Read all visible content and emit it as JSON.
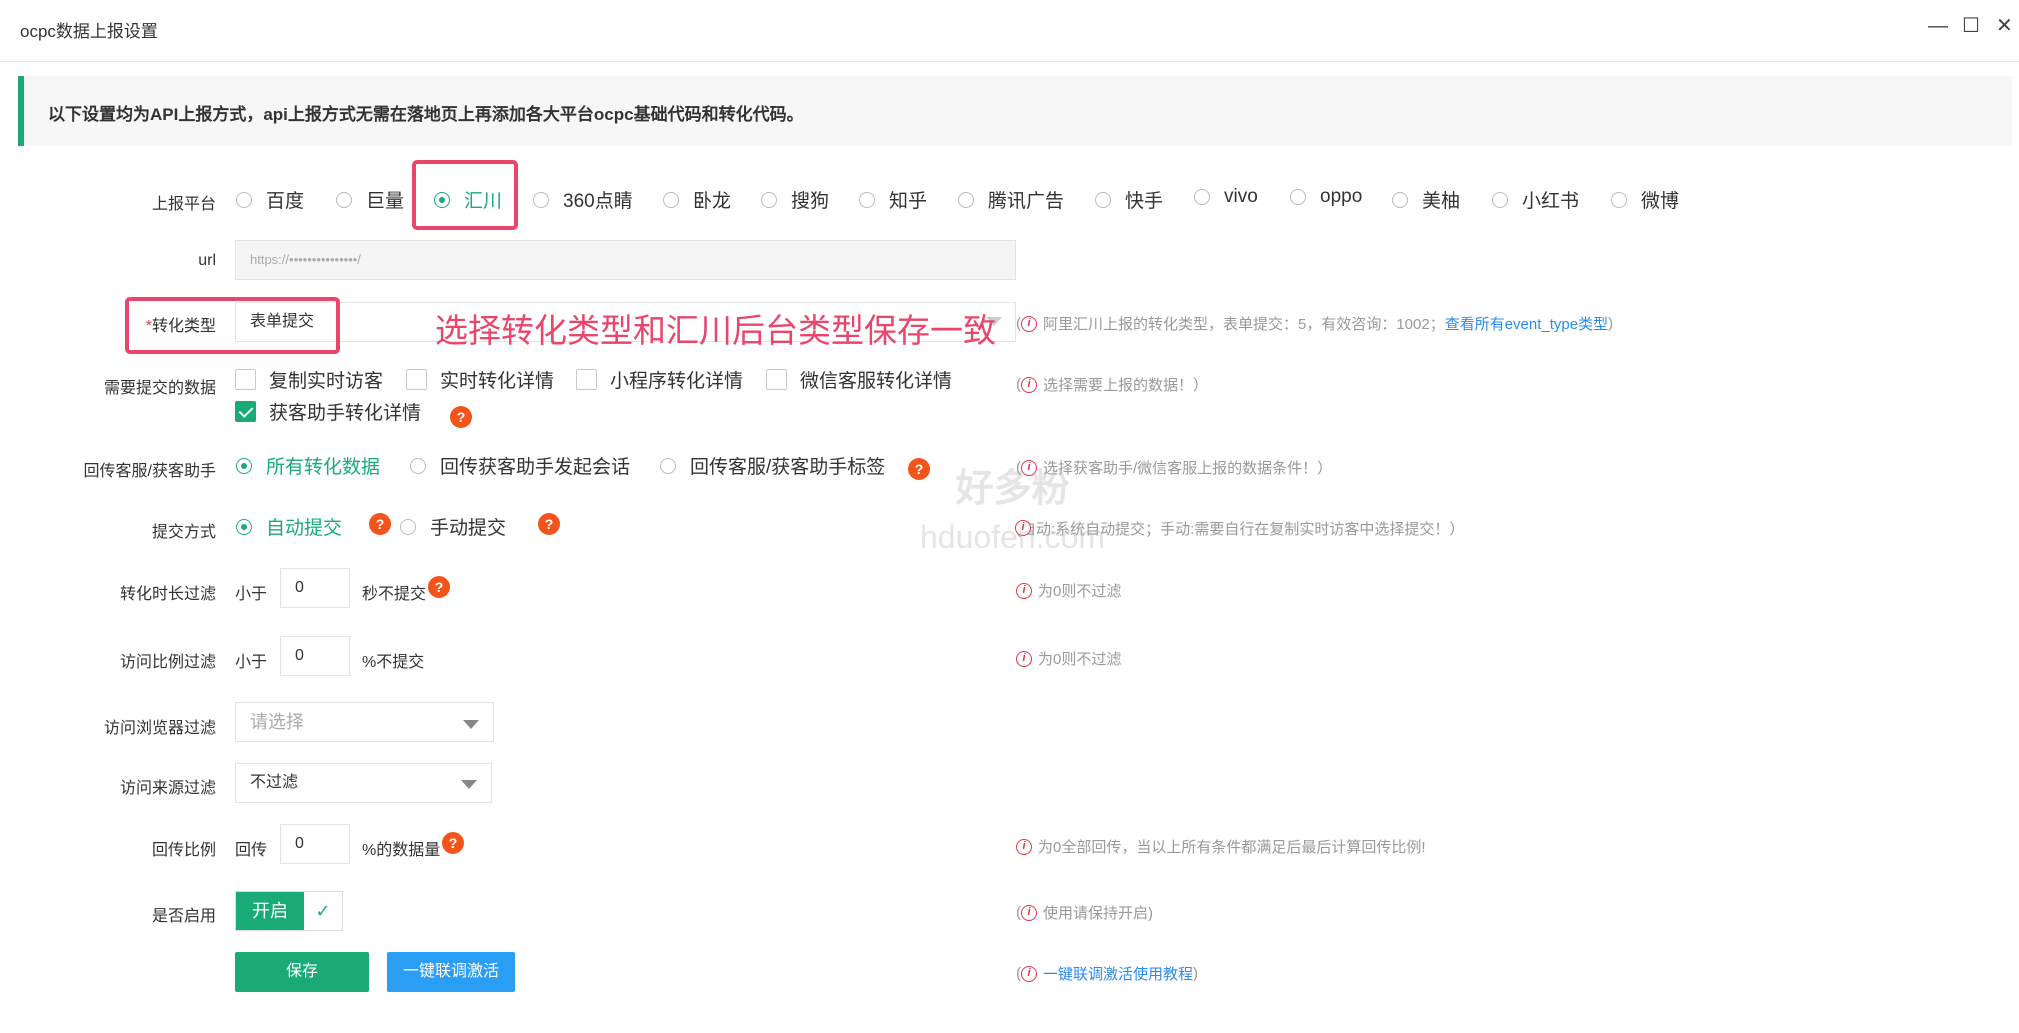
{
  "window": {
    "title": "ocpc数据上报设置",
    "minimize_icon": "—",
    "maximize_icon": "☐",
    "close_icon": "✕"
  },
  "notice": "以下设置均为API上报方式，api上报方式无需在落地页上再添加各大平台ocpc基础代码和转化代码。",
  "platform": {
    "label": "上报平台",
    "options": [
      "百度",
      "巨量",
      "汇川",
      "360点睛",
      "卧龙",
      "搜狗",
      "知乎",
      "腾讯广告",
      "快手",
      "vivo",
      "oppo",
      "美柚",
      "小红书",
      "微博"
    ],
    "selected": "汇川"
  },
  "url": {
    "label": "url",
    "value": "https://•••••••••••••••/"
  },
  "conversion_type": {
    "required_mark": "*",
    "label": "转化类型",
    "value": "表单提交",
    "info": "阿里汇川上报的转化类型，表单提交：5，有效咨询：1002；",
    "link": "查看所有event_type类型",
    "info_open": "(",
    "info_close": ")"
  },
  "annotation": "选择转化类型和汇川后台类型保存一致",
  "data_submit": {
    "label": "需要提交的数据",
    "options": [
      {
        "label": "复制实时访客",
        "checked": false
      },
      {
        "label": "实时转化详情",
        "checked": false
      },
      {
        "label": "小程序转化详情",
        "checked": false
      },
      {
        "label": "微信客服转化详情",
        "checked": false
      },
      {
        "label": "获客助手转化详情",
        "checked": true
      }
    ],
    "info": "选择需要上报的数据！）",
    "info_open": "("
  },
  "callback": {
    "label": "回传客服/获客助手",
    "options": [
      "所有转化数据",
      "回传获客助手发起会话",
      "回传客服/获客助手标签"
    ],
    "selected": "所有转化数据",
    "info": "选择获客助手/微信客服上报的数据条件！）",
    "info_open": "("
  },
  "submit_mode": {
    "label": "提交方式",
    "options": [
      "自动提交",
      "手动提交"
    ],
    "selected": "自动提交",
    "info": "(自动:系统自动提交；手动:需要自行在复制实时访客中选择提交！）"
  },
  "duration_filter": {
    "label": "转化时长过滤",
    "prefix": "小于",
    "value": "0",
    "suffix": "秒不提交",
    "info": "为0则不过滤"
  },
  "ratio_filter": {
    "label": "访问比例过滤",
    "prefix": "小于",
    "value": "0",
    "suffix": "%不提交",
    "info": "为0则不过滤"
  },
  "browser_filter": {
    "label": "访问浏览器过滤",
    "placeholder": "请选择"
  },
  "source_filter": {
    "label": "访问来源过滤",
    "value": "不过滤"
  },
  "callback_ratio": {
    "label": "回传比例",
    "prefix": "回传",
    "value": "0",
    "suffix": "%的数据量",
    "info": "为0全部回传，当以上所有条件都满足后最后计算回传比例!"
  },
  "enabled": {
    "label": "是否启用",
    "on_text": "开启",
    "check_icon": "✓",
    "info": "使用请保持开启)",
    "info_open": "("
  },
  "actions": {
    "save": "保存",
    "activate": "一键联调激活",
    "tutorial": "一键联调激活使用教程",
    "info_open": "(",
    "info_close": ")"
  },
  "help_icon": "?",
  "info_icon": "i",
  "watermark": {
    "line1": "好多粉",
    "line2": "hduofen.com"
  },
  "colors": {
    "accent": "#1aaa75",
    "annotation": "#e8466a",
    "help": "#f2541c",
    "link": "#2a8cf0",
    "button_blue": "#2a9df4"
  }
}
